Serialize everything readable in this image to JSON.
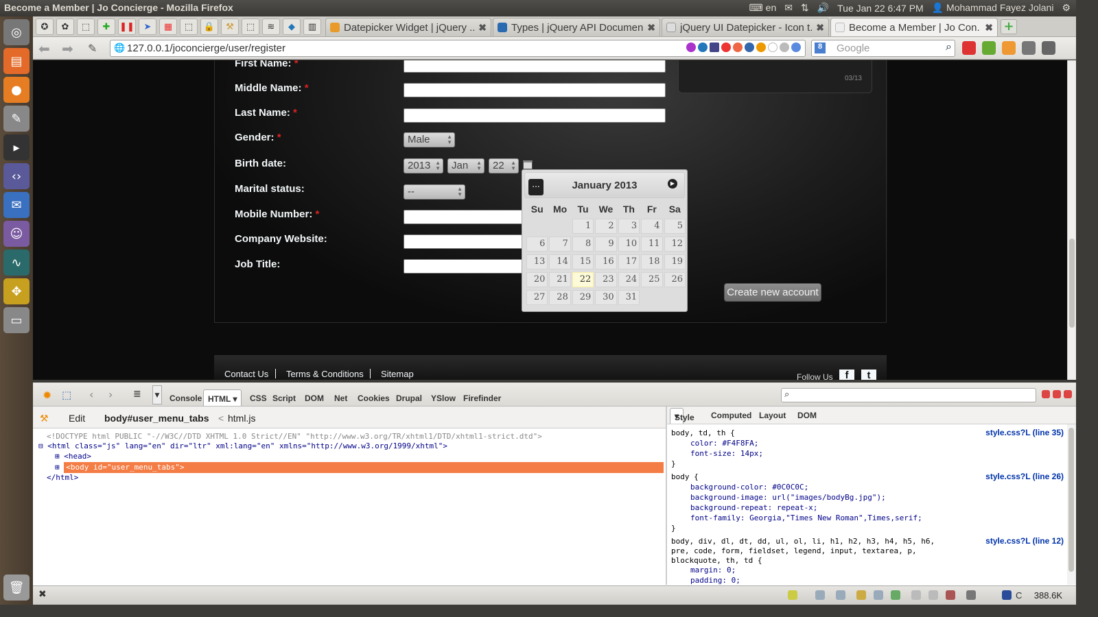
{
  "window": {
    "title": "Become a Member | Jo Concierge - Mozilla Firefox"
  },
  "tray": {
    "keyboard": "en",
    "datetime": "Tue Jan 22  6:47 PM",
    "user": "Mohammad Fayez Jolani"
  },
  "tabs": [
    {
      "label": "Datepicker Widget | jQuery ...",
      "active": false
    },
    {
      "label": "Types | jQuery API Documen...",
      "active": false
    },
    {
      "label": "jQuery UI Datepicker - Icon t...",
      "active": false
    },
    {
      "label": "Become a Member | Jo Con...",
      "active": true
    }
  ],
  "address": {
    "url": "127.0.0.1/joconcierge/user/register"
  },
  "search": {
    "placeholder": "Google"
  },
  "form": {
    "first_name_label": "First Name:",
    "middle_name_label": "Middle Name:",
    "last_name_label": "Last Name:",
    "gender_label": "Gender:",
    "gender_value": "Male",
    "birth_label": "Birth date:",
    "birth_year": "2013",
    "birth_month": "Jan",
    "birth_day": "22",
    "marital_label": "Marital status:",
    "marital_value": "--",
    "mobile_label": "Mobile Number:",
    "website_label": "Company Website:",
    "job_label": "Job Title:",
    "required_mark": "*",
    "create_button": "Create new account"
  },
  "side_box": {
    "valid_text": "03/13"
  },
  "footer": {
    "contact": "Contact Us",
    "terms": "Terms & Conditions",
    "sitemap": "Sitemap",
    "follow": "Follow Us",
    "fb": "f",
    "tw": "t"
  },
  "datepicker": {
    "prev": "...",
    "month_title": "January 2013",
    "weekdays": [
      "Su",
      "Mo",
      "Tu",
      "We",
      "Th",
      "Fr",
      "Sa"
    ],
    "weeks": [
      [
        "",
        "",
        "1",
        "2",
        "3",
        "4",
        "5"
      ],
      [
        "6",
        "7",
        "8",
        "9",
        "10",
        "11",
        "12"
      ],
      [
        "13",
        "14",
        "15",
        "16",
        "17",
        "18",
        "19"
      ],
      [
        "20",
        "21",
        "22",
        "23",
        "24",
        "25",
        "26"
      ],
      [
        "27",
        "28",
        "29",
        "30",
        "31",
        "",
        ""
      ]
    ],
    "today": "22"
  },
  "devtools": {
    "tabs": [
      "Console",
      "HTML",
      "CSS",
      "Script",
      "DOM",
      "Net",
      "Cookies",
      "Drupal",
      "YSlow",
      "Firefinder"
    ],
    "edit": "Edit",
    "crumb_body": "body#user_menu_tabs",
    "crumb_sep": "<",
    "crumb_html": "html.js",
    "side_tabs": [
      "Style",
      "Computed",
      "Layout",
      "DOM"
    ],
    "html_lines": {
      "doctype": "<!DOCTYPE html PUBLIC \"-//W3C//DTD XHTML 1.0 Strict//EN\" \"http://www.w3.org/TR/xhtml1/DTD/xhtml1-strict.dtd\">",
      "html_open": "<html class=\"js\" lang=\"en\" dir=\"ltr\" xml:lang=\"en\" xmlns=\"http://www.w3.org/1999/xhtml\">",
      "head": "<head>",
      "body": "<body id=\"user_menu_tabs\">",
      "html_close": "</html>"
    },
    "rules": [
      {
        "selector": "body, td, th {",
        "source": "style.css?L (line 35)",
        "props": [
          "color: #F4F8FA;",
          "font-size: 14px;"
        ]
      },
      {
        "selector": "body {",
        "source": "style.css?L (line 26)",
        "props": [
          "background-color: #0C0C0C;",
          "background-image: url(\"images/bodyBg.jpg\");",
          "background-repeat: repeat-x;",
          "font-family: Georgia,\"Times New Roman\",Times,serif;"
        ]
      },
      {
        "selector": "body, div, dl, dt, dd, ul, ol, li, h1, h2, h3, h4, h5, h6,",
        "selector2": "pre, code, form, fieldset, legend, input, textarea, p,",
        "selector3": "blockquote, th, td {",
        "source": "style.css?L (line 12)",
        "props": [
          "margin: 0;",
          "padding: 0;"
        ]
      }
    ],
    "close_brace": "}",
    "status_size": "388.6K",
    "status_c": "C"
  }
}
